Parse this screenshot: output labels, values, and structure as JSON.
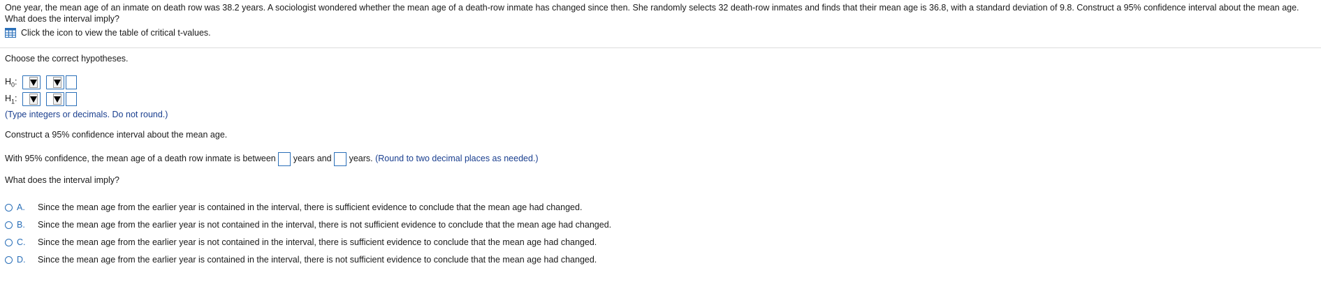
{
  "problem": {
    "text": "One year, the mean age of an inmate on death row was 38.2 years. A sociologist wondered whether the mean age of a death-row inmate has changed since then. She randomly selects 32 death-row inmates and finds that their mean age is 36.8, with a standard deviation of 9.8. Construct a 95% confidence interval about the mean age. What does the interval imply?"
  },
  "table_link": {
    "label": "Click the icon to view the table of critical t-values.",
    "icon": "table-icon"
  },
  "hypotheses": {
    "prompt": "Choose the correct hypotheses.",
    "h0_letter": "H",
    "h0_sub": "0",
    "h1_letter": "H",
    "h1_sub": "1",
    "colon": ":",
    "instruction": "(Type integers or decimals. Do not round.)"
  },
  "interval": {
    "prompt": "Construct a 95% confidence interval about the mean age.",
    "sentence_start": "With 95% confidence, the mean age of a death row inmate is between",
    "sentence_mid": "years and",
    "sentence_end": "years.",
    "hint": "(Round to two decimal places as needed.)"
  },
  "implication": {
    "prompt": "What does the interval imply?",
    "options": [
      {
        "letter": "A.",
        "text": "Since the mean age from the earlier year is contained in the interval, there is sufficient evidence to conclude that the mean age had changed."
      },
      {
        "letter": "B.",
        "text": "Since the mean age from the earlier year is not contained in the interval, there is not sufficient evidence to conclude that the mean age had changed."
      },
      {
        "letter": "C.",
        "text": "Since the mean age from the earlier year is not contained in the interval, there is sufficient evidence to conclude that the mean age had changed."
      },
      {
        "letter": "D.",
        "text": "Since the mean age from the earlier year is contained in the interval, there is not sufficient evidence to conclude that the mean age had changed."
      }
    ]
  },
  "colors": {
    "accent": "#2a6fb8",
    "hint": "#1a3f8f",
    "text": "#1a1a1a"
  }
}
